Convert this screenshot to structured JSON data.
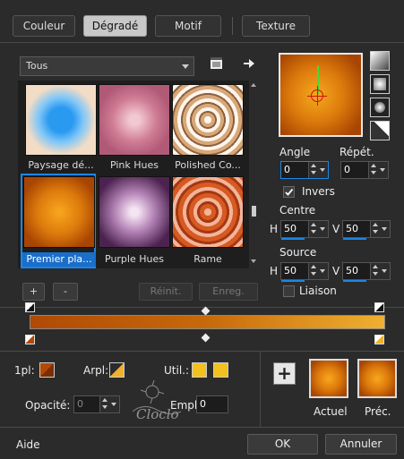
{
  "tabs": [
    {
      "label": "Couleur"
    },
    {
      "label": "Dégradé"
    },
    {
      "label": "Motif"
    },
    {
      "label": "Texture"
    }
  ],
  "dropdown": {
    "value": "Tous"
  },
  "gallery": {
    "items": [
      {
        "label": "Paysage dé..."
      },
      {
        "label": "Pink Hues"
      },
      {
        "label": "Polished Co..."
      },
      {
        "label": "Premier pla..."
      },
      {
        "label": "Purple Hues"
      },
      {
        "label": "Rame"
      }
    ],
    "selected": "Premier pla..."
  },
  "gallery_buttons": {
    "add": "+",
    "remove": "-",
    "reset": "Réinit.",
    "save": "Enreg."
  },
  "settings": {
    "angle_label": "Angle",
    "angle_value": "0",
    "repeat_label": "Répét.",
    "repeat_value": "0",
    "invert_label": "Invers",
    "invert_checked": true,
    "center_label": "Centre",
    "center_h_label": "H",
    "center_h": "50",
    "center_v_label": "V",
    "center_v": "50",
    "source_label": "Source",
    "source_h_label": "H",
    "source_h": "50",
    "source_v_label": "V",
    "source_v": "50",
    "link_label": "Liaison",
    "link_checked": false
  },
  "stops": {
    "first_label": "1pl:",
    "arpl_label": "Arpl:",
    "util_label": "Util.:",
    "opacity_label": "Opacité:",
    "opacity_value": "0",
    "empl_label": "Empl.:",
    "empl_value": "0"
  },
  "watermark": "Cloclo",
  "preview": {
    "current_label": "Actuel",
    "previous_label": "Préc."
  },
  "footer": {
    "help": "Aide",
    "ok": "OK",
    "cancel": "Annuler"
  },
  "colors": {
    "accent": "#1b86e6",
    "dark_orange": "#b04a05",
    "orange": "#e58c10",
    "light_orange": "#f0b030",
    "yellow": "#f2c01f"
  }
}
